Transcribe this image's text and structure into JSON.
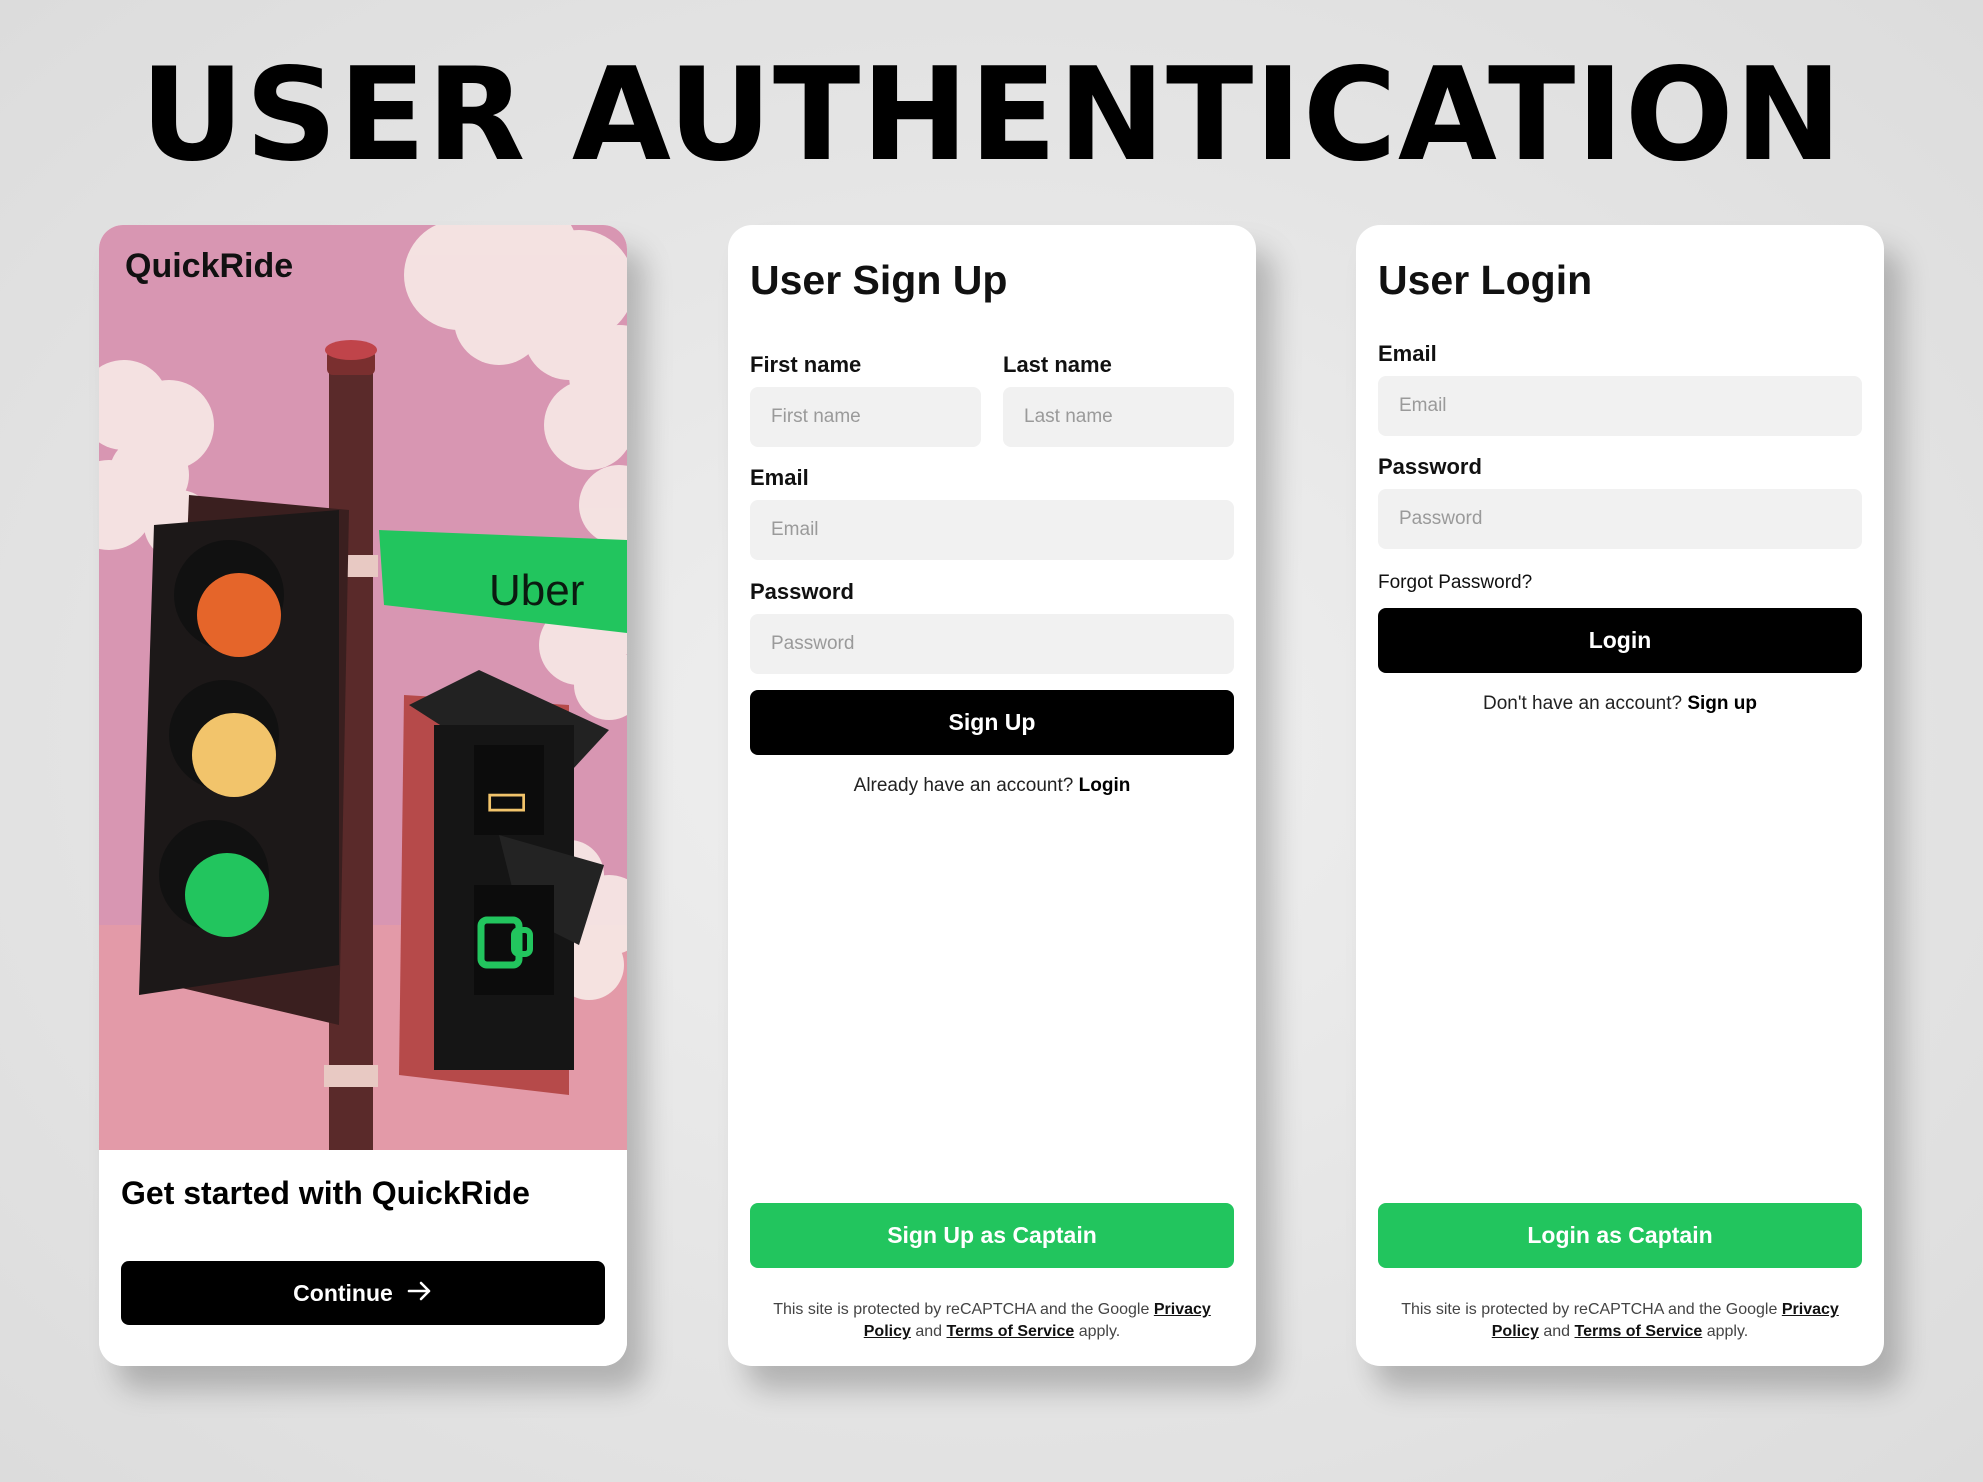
{
  "page": {
    "title": "USER AUTHENTICATION"
  },
  "welcome": {
    "brand": "QuickRide",
    "sign_text": "Uber",
    "heading": "Get started with QuickRide",
    "continue_label": "Continue",
    "continue_icon": "arrow-right-icon",
    "colors": {
      "bg": "#d896b2",
      "sign": "#22c55e"
    }
  },
  "signup": {
    "title": "User Sign Up",
    "first_name_label": "First name",
    "first_name_placeholder": "First name",
    "last_name_label": "Last name",
    "last_name_placeholder": "Last name",
    "email_label": "Email",
    "email_placeholder": "Email",
    "password_label": "Password",
    "password_placeholder": "Password",
    "submit_label": "Sign Up",
    "switch_prefix": "Already have an account?",
    "switch_link": "Login",
    "captain_label": "Sign Up as Captain",
    "legal_prefix": "This site is protected by reCAPTCHA and the Google",
    "legal_privacy": "Privacy Policy",
    "legal_and": "and",
    "legal_terms": "Terms of Service",
    "legal_suffix": "apply."
  },
  "login": {
    "title": "User Login",
    "email_label": "Email",
    "email_placeholder": "Email",
    "password_label": "Password",
    "password_placeholder": "Password",
    "forgot_label": "Forgot Password?",
    "submit_label": "Login",
    "switch_prefix": "Don't have an account?",
    "switch_link": "Sign up",
    "captain_label": "Login as Captain",
    "legal_prefix": "This site is protected by reCAPTCHA and the Google",
    "legal_privacy": "Privacy Policy",
    "legal_and": "and",
    "legal_terms": "Terms of Service",
    "legal_suffix": "apply."
  },
  "colors": {
    "accent_green": "#22c55e",
    "button_black": "#000000",
    "input_bg": "#f1f1f1"
  }
}
